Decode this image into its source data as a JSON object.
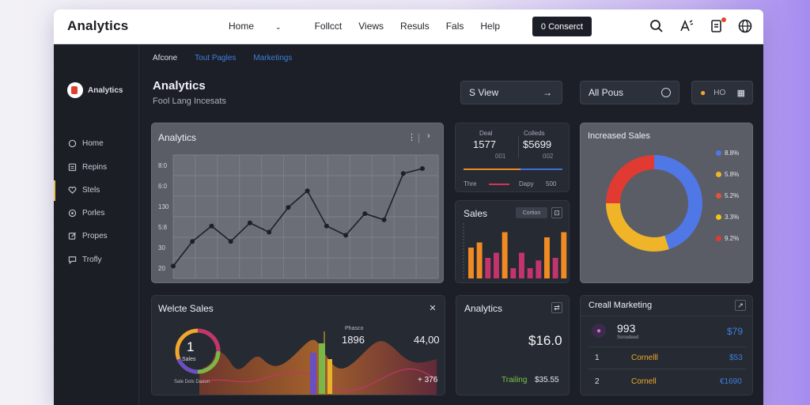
{
  "topbar": {
    "brand": "Analytics",
    "nav": [
      "Home",
      "Follcct",
      "Views",
      "Resuls",
      "Fals",
      "Help"
    ],
    "contact_button": "0 Conserct"
  },
  "sidebar": {
    "logo_text": "Analytics",
    "items": [
      {
        "label": "Home",
        "icon": "home-icon"
      },
      {
        "label": "Repins",
        "icon": "report-icon"
      },
      {
        "label": "Stels",
        "icon": "heart-icon"
      },
      {
        "label": "Porles",
        "icon": "folder-icon"
      },
      {
        "label": "Propes",
        "icon": "edit-icon"
      },
      {
        "label": "Trofly",
        "icon": "chat-icon"
      }
    ]
  },
  "subtabs": [
    "Afcone",
    "Tout Pagles",
    "Marketings"
  ],
  "header": {
    "title": "Analytics",
    "subtitle": "Fool Lang Incesats",
    "view_button": "S View",
    "dropdown": "All Pous",
    "chip": "HO"
  },
  "main_chart": {
    "title": "Analytics",
    "y_ticks": [
      "30",
      "60",
      "90",
      "120",
      "150",
      "180"
    ],
    "ytick_labels": [
      "20",
      "30",
      "5:8",
      "130",
      "6:0",
      "8:0"
    ]
  },
  "chart_data": [
    {
      "type": "line",
      "title": "Analytics",
      "x": [
        0,
        1,
        2,
        3,
        4,
        5,
        6,
        7,
        8,
        9,
        10,
        11,
        12,
        13
      ],
      "values": [
        20,
        60,
        85,
        60,
        90,
        75,
        115,
        142,
        85,
        70,
        105,
        95,
        170,
        178
      ],
      "ylim": [
        0,
        200
      ],
      "grid": true
    },
    {
      "type": "bar",
      "title": "Sales",
      "values": [
        60,
        70,
        40,
        50,
        90,
        20,
        50,
        20,
        35,
        80,
        40,
        90
      ],
      "colors": [
        "#f08a24",
        "#f08a24",
        "#c2346b",
        "#c2346b",
        "#f08a24",
        "#c2346b",
        "#c2346b",
        "#c2346b",
        "#c2346b",
        "#f08a24",
        "#c2346b",
        "#f08a24"
      ]
    },
    {
      "type": "pie",
      "title": "Increased Sales",
      "values": [
        45,
        30,
        25
      ],
      "colors": [
        "#4f78e6",
        "#f0b429",
        "#e03a33"
      ],
      "legend": [
        {
          "label": "8.8%",
          "color": "#4f78e6"
        },
        {
          "label": "5.8%",
          "color": "#f0b429"
        },
        {
          "label": "5.2%",
          "color": "#e0553a"
        },
        {
          "label": "3.3%",
          "color": "#f0c419"
        },
        {
          "label": "9.2%",
          "color": "#e03a33"
        }
      ]
    }
  ],
  "stats_card": {
    "left_label": "Deal",
    "left_value": "1577",
    "left_sub": "001",
    "right_label": "Colleds",
    "right_value": "$5699",
    "right_sub": "002",
    "foot_left": "Thre",
    "foot_mid": "Dapy",
    "foot_right": "500"
  },
  "sales_card": {
    "title": "Sales",
    "badge": "Cortion"
  },
  "website_sales": {
    "title": "Welcte Sales",
    "ring_value": "1",
    "ring_label": "Sales",
    "value1": "1896",
    "label1": "Phasco",
    "value2": "44,00",
    "value3": "+ 376",
    "caption": "Sale Dols Daoun"
  },
  "analytics_card": {
    "title": "Analytics",
    "value": "$16.0",
    "foot_label": "Trailing",
    "foot_value": "$35.55"
  },
  "marketing_card": {
    "title": "Creall Marketing",
    "top_value": "993",
    "top_sub": "Sonodeed",
    "top_amount": "$79",
    "rows": [
      {
        "rank": "1",
        "name": "Cornelll",
        "amount": "$53"
      },
      {
        "rank": "2",
        "name": "Cornell",
        "amount": "€1690"
      }
    ]
  }
}
